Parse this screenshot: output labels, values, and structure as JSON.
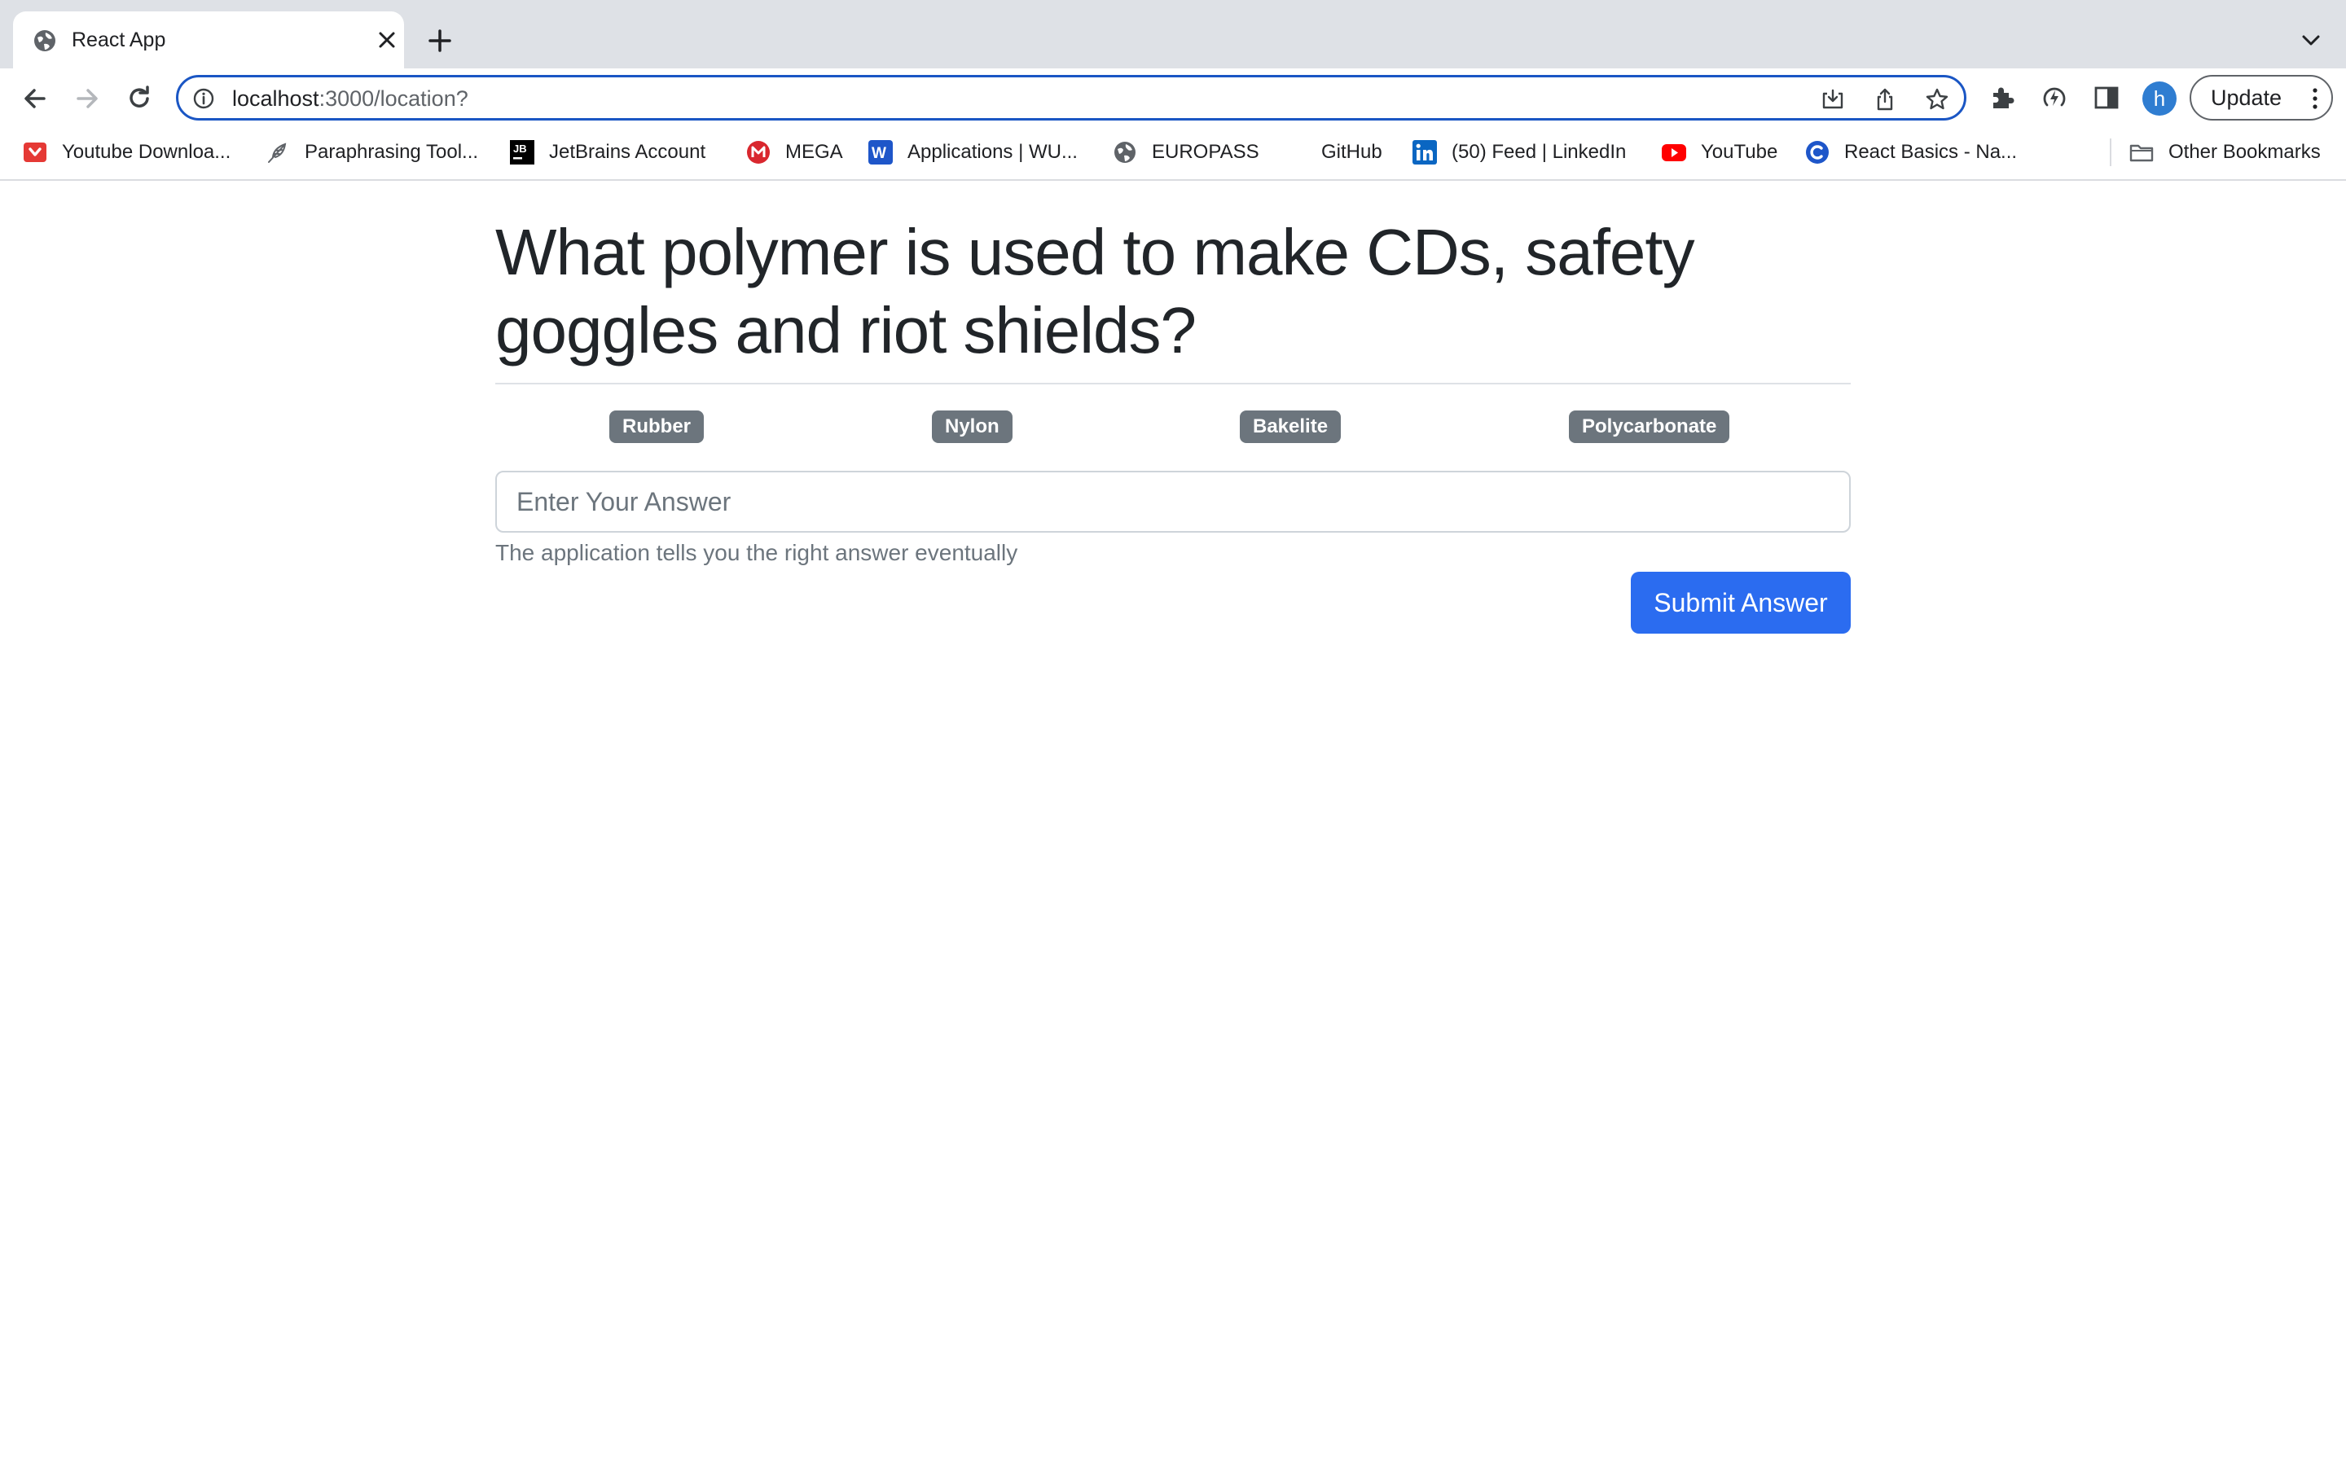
{
  "browser": {
    "tab": {
      "title": "React App"
    },
    "url": {
      "host": "localhost",
      "path": ":3000/location?"
    },
    "update_label": "Update",
    "avatar_initial": "h",
    "bookmarks": [
      {
        "label": "Youtube Downloa...",
        "icon": "youtube-downloader-icon"
      },
      {
        "label": "Paraphrasing Tool...",
        "icon": "feather-icon"
      },
      {
        "label": "JetBrains Account",
        "icon": "jetbrains-icon"
      },
      {
        "label": "MEGA",
        "icon": "mega-icon"
      },
      {
        "label": "Applications | WU...",
        "icon": "w-icon"
      },
      {
        "label": "EUROPASS",
        "icon": "globe-icon"
      },
      {
        "label": "GitHub",
        "icon": "github-icon"
      },
      {
        "label": "(50) Feed | LinkedIn",
        "icon": "linkedin-icon"
      },
      {
        "label": "YouTube",
        "icon": "youtube-icon"
      },
      {
        "label": "React Basics - Na...",
        "icon": "react-basics-icon"
      }
    ],
    "other_bookmarks": "Other Bookmarks"
  },
  "quiz": {
    "question": "What polymer is used to make CDs, safety goggles and riot shields?",
    "options": [
      "Rubber",
      "Nylon",
      "Bakelite",
      "Polycarbonate"
    ],
    "answer_value": "",
    "answer_placeholder": "Enter Your Answer",
    "help_text": "The application tells you the right answer eventually",
    "submit_label": "Submit Answer"
  },
  "colors": {
    "accent": "#2b6cf0",
    "badge": "#6c757d",
    "omnibox_border": "#1a56c4"
  }
}
